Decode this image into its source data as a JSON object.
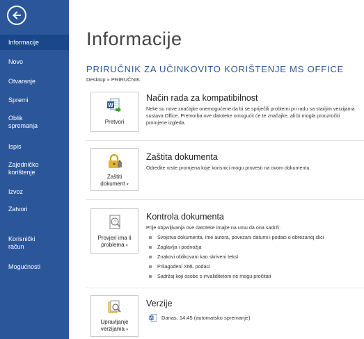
{
  "sidebar": {
    "items": [
      {
        "label": "Informacije"
      },
      {
        "label": "Novo"
      },
      {
        "label": "Otvaranje"
      },
      {
        "label": "Spremi"
      },
      {
        "label": "Oblik spremanja"
      },
      {
        "label": "Ispis"
      },
      {
        "label": "Zajedničko korištenje"
      },
      {
        "label": "Izvoz"
      },
      {
        "label": "Zatvori"
      },
      {
        "label": "Korisnički račun"
      },
      {
        "label": "Mogućnosti"
      }
    ]
  },
  "header": {
    "title": "Informacije",
    "doc_title": "PRIRUČNIK ZA UČINKOVITO KORIŠTENJE MS OFFICE",
    "path": "Desktop » PRIRUČNIK"
  },
  "sections": {
    "compat": {
      "button_label": "Pretvori",
      "heading": "Način rada za kompatibilnost",
      "text": "Neke su nove značajke onemogućene da bi se spriječili problemi pri radu sa starijim verzijama sustava Office. Pretvorba ove datoteke omogućit će te značajke, ali bi mogla prouzročiti promjene izgleda."
    },
    "protect": {
      "button_line1": "Zaštiti",
      "button_line2": "dokument",
      "heading": "Zaštita dokumenta",
      "text": "Odredite vrste promjena koje korisnici mogu provesti na ovom dokumentu."
    },
    "inspect": {
      "button_line1": "Provjeri ima li",
      "button_line2": "problema",
      "heading": "Kontrola dokumenta",
      "text": "Prije objavljivanja ove datoteke imajte na umu da ona sadrži:",
      "bullets": [
        "Svojstva dokumenta, ime autora, povezani datumi i podaci o obrezanoj slici",
        "Zaglavlja i podnožja",
        "Znakovi oblikovani kao skriveni tekst",
        "Prilagođeni XML podaci",
        "Sadržaj koji osobe s invaliditetom ne mogu pročitati"
      ]
    },
    "versions": {
      "button_line1": "Upravljanje",
      "button_line2": "verzijama",
      "heading": "Verzije",
      "entry": "Danas, 14:45 (automatsko spremanje)"
    }
  },
  "colors": {
    "sidebar": "#2b579a",
    "sidebar_active": "#19478a",
    "accent": "#2b579a"
  }
}
